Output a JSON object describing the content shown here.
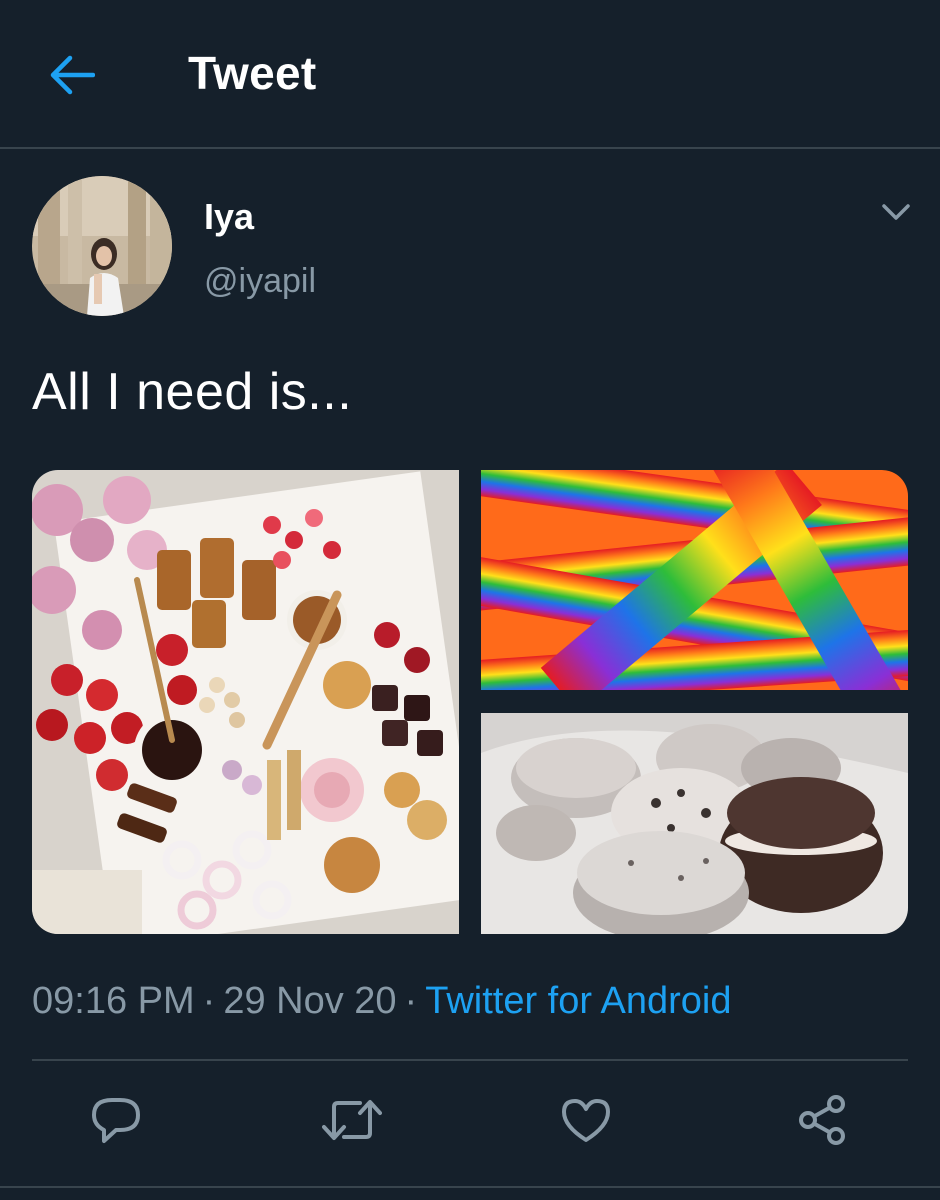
{
  "header": {
    "title": "Tweet",
    "back_icon": "arrow-left-icon"
  },
  "user": {
    "name": "Iya",
    "handle": "@iyapil"
  },
  "tweet": {
    "text": "All I need is...",
    "time": "09:16 PM",
    "date": "29 Nov 20",
    "source": "Twitter for Android",
    "separator": "·"
  },
  "media": [
    {
      "subject": "dessert-board-photo"
    },
    {
      "subject": "rainbow-sour-belts-photo"
    },
    {
      "subject": "cookies-and-cream-macarons-photo"
    }
  ],
  "actions": [
    "reply-icon",
    "retweet-icon",
    "like-icon",
    "share-icon"
  ],
  "colors": {
    "background": "#15202b",
    "divider": "#38444d",
    "accent": "#1da1f2",
    "secondary_text": "#8899a6"
  }
}
